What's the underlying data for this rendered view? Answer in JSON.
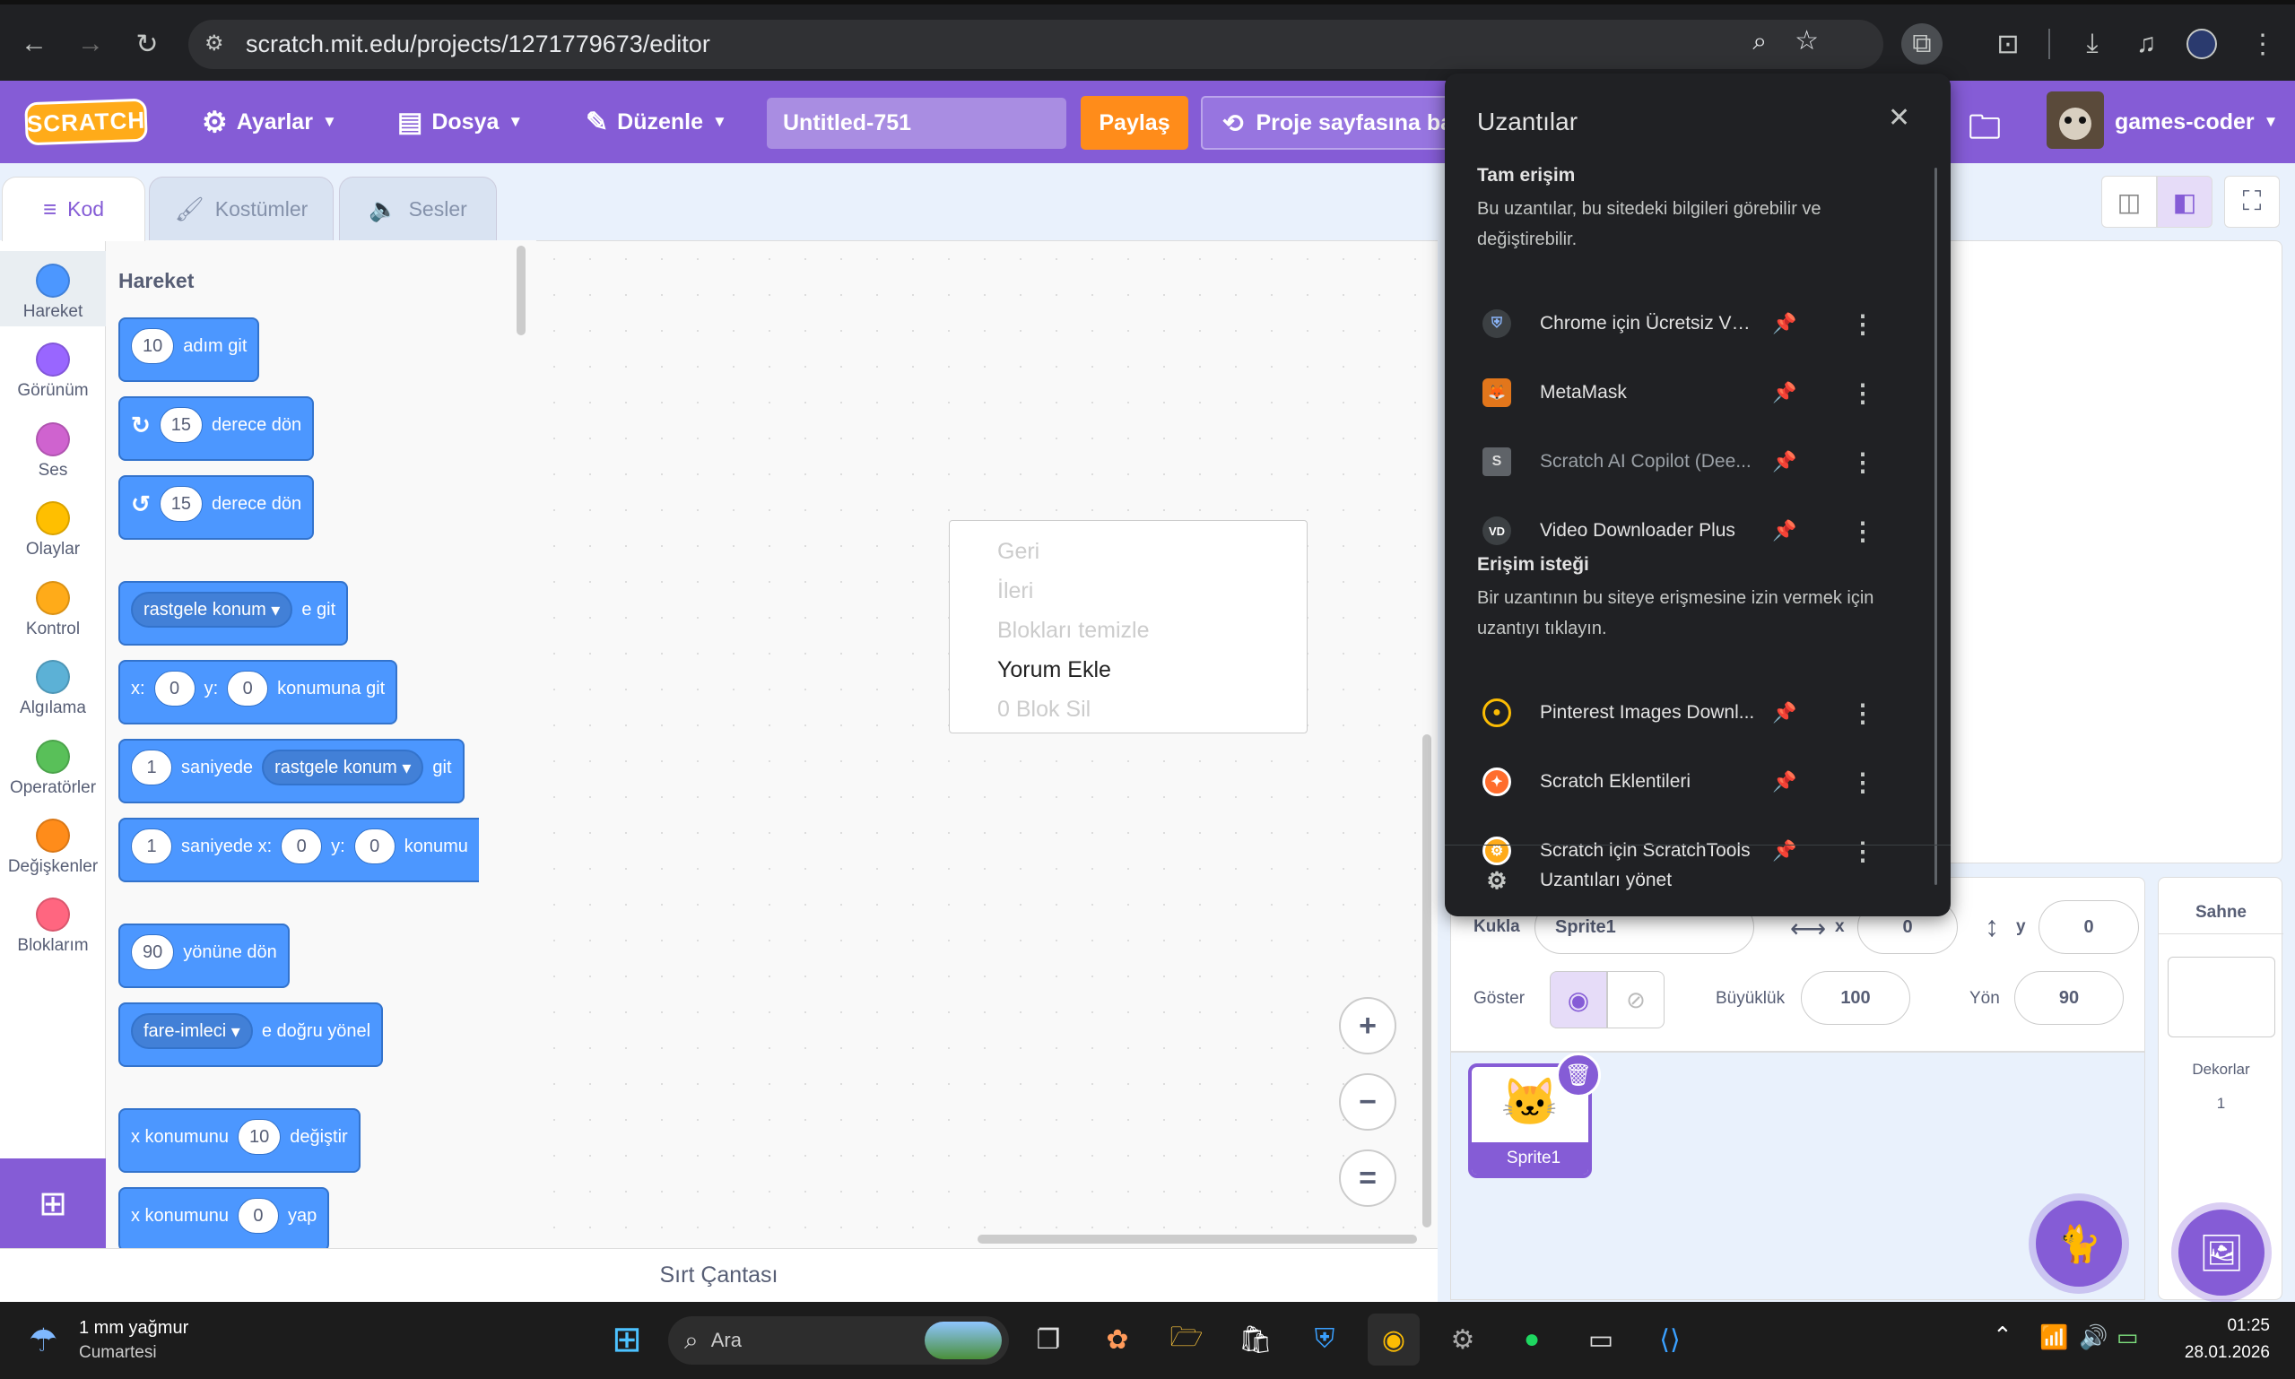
{
  "browser": {
    "url": "scratch.mit.edu/projects/1271779673/editor"
  },
  "menubar": {
    "logo": "SCRATCH",
    "settings": "Ayarlar",
    "file": "Dosya",
    "edit": "Düzenle",
    "project_title": "Untitled-751",
    "share": "Paylaş",
    "see_project": "Proje sayfasına ba",
    "username": "games-coder"
  },
  "tabs": {
    "code": "Kod",
    "costumes": "Kostümler",
    "sounds": "Sesler"
  },
  "categories": [
    {
      "label": "Hareket",
      "color": "#4c97ff"
    },
    {
      "label": "Görünüm",
      "color": "#9966ff"
    },
    {
      "label": "Ses",
      "color": "#cf63cf"
    },
    {
      "label": "Olaylar",
      "color": "#ffbf00"
    },
    {
      "label": "Kontrol",
      "color": "#ffab19"
    },
    {
      "label": "Algılama",
      "color": "#5cb1d6"
    },
    {
      "label": "Operatörler",
      "color": "#59c059"
    },
    {
      "label": "Değişkenler",
      "color": "#ff8c1a"
    },
    {
      "label": "Bloklarım",
      "color": "#ff6680"
    }
  ],
  "palette": {
    "heading": "Hareket",
    "b1": {
      "v": "10",
      "t": "adım git"
    },
    "b2": {
      "v": "15",
      "t": "derece dön"
    },
    "b3": {
      "v": "15",
      "t": "derece dön"
    },
    "b4": {
      "d": "rastgele konum",
      "t": "e git"
    },
    "b5": {
      "x": "x:",
      "xv": "0",
      "y": "y:",
      "yv": "0",
      "t": "konumuna git"
    },
    "b6": {
      "v": "1",
      "t1": "saniyede",
      "d": "rastgele konum",
      "t2": "git"
    },
    "b7": {
      "v": "1",
      "t1": "saniyede x:",
      "xv": "0",
      "y": "y:",
      "yv": "0",
      "t2": "konumu"
    },
    "b8": {
      "v": "90",
      "t": "yönüne dön"
    },
    "b9": {
      "d": "fare-imleci",
      "t": "e doğru yönel"
    },
    "b10": {
      "t1": "x konumunu",
      "v": "10",
      "t2": "değiştir"
    },
    "b11": {
      "t1": "x konumunu",
      "v": "0",
      "t2": "yap"
    }
  },
  "context_menu": {
    "items": [
      "Geri",
      "İleri",
      "Blokları temizle",
      "Yorum Ekle",
      "0 Blok Sil"
    ]
  },
  "backpack": "Sırt Çantası",
  "sprite_info": {
    "sprite_label": "Kukla",
    "sprite_name": "Sprite1",
    "x_label": "x",
    "x": "0",
    "y_label": "y",
    "y": "0",
    "show_label": "Göster",
    "size_label": "Büyüklük",
    "size": "100",
    "direction_label": "Yön",
    "direction": "90"
  },
  "sprite_list": [
    {
      "name": "Sprite1"
    }
  ],
  "stage_panel": {
    "title": "Sahne",
    "backdrops_label": "Dekorlar",
    "backdrops_count": "1"
  },
  "extensions": {
    "title": "Uzantılar",
    "full_access_title": "Tam erişim",
    "full_access_desc": "Bu uzantılar, bu sitedeki bilgileri görebilir ve değiştirebilir.",
    "full_access": [
      {
        "name": "Chrome için Ücretsiz VP..."
      },
      {
        "name": "MetaMask"
      },
      {
        "name": "Scratch AI Copilot (Dee..."
      },
      {
        "name": "Video Downloader Plus"
      }
    ],
    "request_title": "Erişim isteği",
    "request_desc": "Bir uzantının bu siteye erişmesine izin vermek için uzantıyı tıklayın.",
    "requested": [
      {
        "name": "Pinterest Images Downl..."
      },
      {
        "name": "Scratch Eklentileri"
      },
      {
        "name": "Scratch için ScratchTools"
      }
    ],
    "manage": "Uzantıları yönet"
  },
  "taskbar": {
    "weather_title": "1 mm yağmur",
    "weather_sub": "Cumartesi",
    "search": "Ara",
    "time": "01:25",
    "date": "28.01.2026"
  }
}
